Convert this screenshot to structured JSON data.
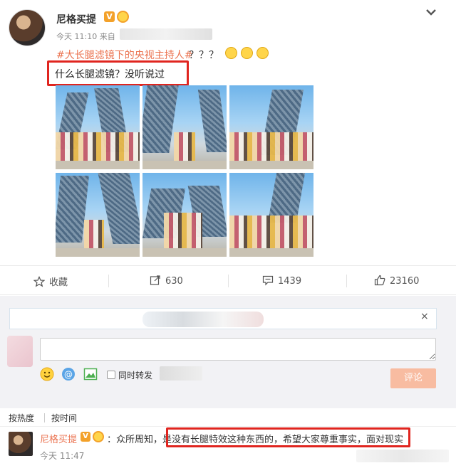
{
  "post": {
    "author": "尼格买提",
    "v_badge": "V",
    "meta_time": "今天 11:10 来自",
    "topic": "#大长腿滤镜下的央视主持人#",
    "topic_suffix": "？？？",
    "caption": "什么长腿滤镜？没听说过",
    "icons": {
      "verified": "v-badge-icon",
      "member": "crown-badge-icon",
      "expand": "chevron-down-icon"
    }
  },
  "actions": {
    "favorite_label": "收藏",
    "share_count": "630",
    "comment_count": "1439",
    "like_count": "23160"
  },
  "composer": {
    "close_label": "×",
    "forward_label": "同时转发",
    "submit_label": "评论",
    "placeholder": ""
  },
  "sort": {
    "hot": "按热度",
    "time": "按时间"
  },
  "comment": {
    "author": "尼格买提",
    "v_badge": "V",
    "text": "：众所周知，是没有长腿特效这种东西的，希望大家尊重事实，面对现实",
    "time": "今天 11:47"
  },
  "colors": {
    "accent": "#eb7350",
    "highlight_box": "#e0251f",
    "submit_button": "#f8bca1"
  }
}
